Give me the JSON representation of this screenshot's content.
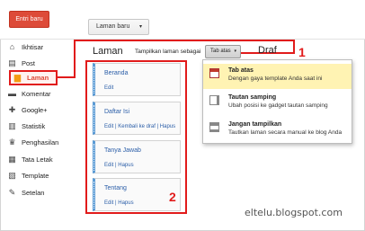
{
  "toolbar": {
    "entri_baru": "Entri baru",
    "laman_baru": "Laman baru",
    "caret": "▾"
  },
  "sidebar": {
    "items": [
      {
        "label": "Ikhtisar",
        "icon": "home-icon"
      },
      {
        "label": "Post",
        "icon": "post-icon"
      },
      {
        "label": "Laman",
        "icon": "page-icon",
        "active": true
      },
      {
        "label": "Komentar",
        "icon": "comment-icon"
      },
      {
        "label": "Google+",
        "icon": "google-plus-icon"
      },
      {
        "label": "Statistik",
        "icon": "stats-icon"
      },
      {
        "label": "Penghasilan",
        "icon": "trophy-icon"
      },
      {
        "label": "Tata Letak",
        "icon": "layout-icon"
      },
      {
        "label": "Template",
        "icon": "template-icon"
      },
      {
        "label": "Setelan",
        "icon": "wrench-icon"
      }
    ]
  },
  "main": {
    "title": "Laman",
    "tampilkan_label": "Tampilkan laman sebagai",
    "tab_atas_label": "Tab atas",
    "draf_title": "Draf",
    "marker_1": "1",
    "marker_2": "2",
    "pages": [
      {
        "name": "Beranda",
        "actions": "Edit"
      },
      {
        "name": "Daftar Isi",
        "actions": "Edit | Kembali ke draf | Hapus"
      },
      {
        "name": "Tanya Jawab",
        "actions": "Edit | Hapus"
      },
      {
        "name": "Tentang",
        "actions": "Edit | Hapus"
      }
    ]
  },
  "menu": {
    "items": [
      {
        "title": "Tab atas",
        "desc": "Dengan gaya template Anda saat ini",
        "selected": true
      },
      {
        "title": "Tautan samping",
        "desc": "Ubah posisi ke gadget tautan samping"
      },
      {
        "title": "Jangan tampilkan",
        "desc": "Tautkan laman secara manual ke blog Anda"
      }
    ]
  },
  "watermark": "eltelu.blogspot.com",
  "colors": {
    "accent_red": "#e11b1b",
    "button_orange": "#dd4b39",
    "link_blue": "#2b5ea8",
    "selected_yellow": "#fff3b3",
    "card_border_blue": "#5b9bd5"
  }
}
